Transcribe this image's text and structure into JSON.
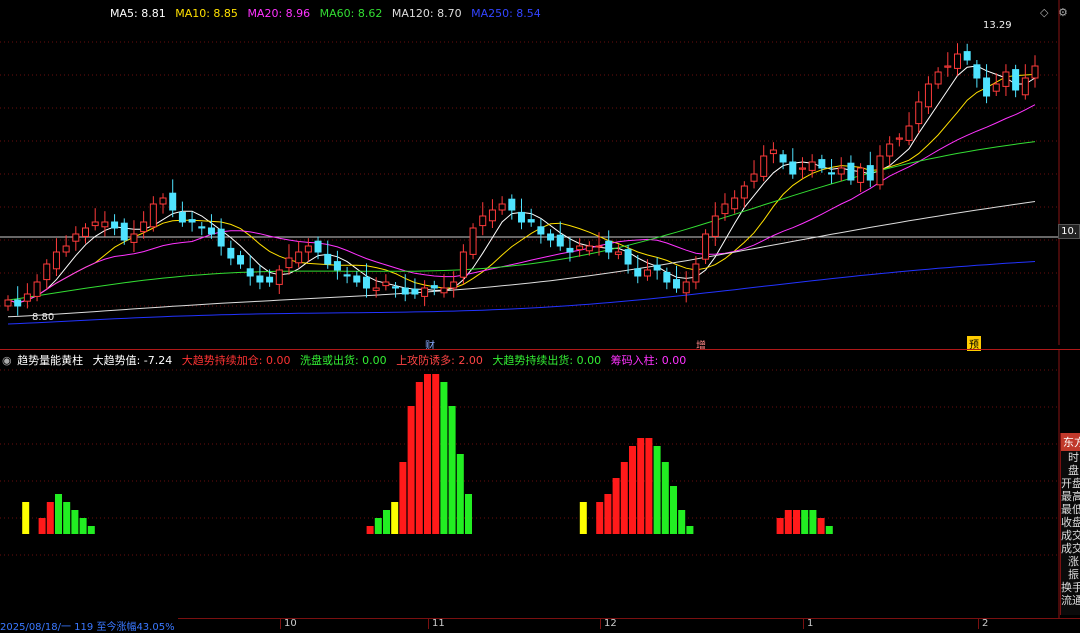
{
  "main": {
    "stock_title": "",
    "ma_legend": [
      {
        "label": "MA5: 8.81",
        "color": "#ffffff"
      },
      {
        "label": "MA10: 8.85",
        "color": "#ffe000"
      },
      {
        "label": "MA20: 8.96",
        "color": "#ff33ff"
      },
      {
        "label": "MA60: 8.62",
        "color": "#33dd33"
      },
      {
        "label": "MA120: 8.70",
        "color": "#dddddd"
      },
      {
        "label": "MA250: 8.54",
        "color": "#3344ff"
      }
    ],
    "high_label": "13.29",
    "low_label": "8.80",
    "right_price": "10.",
    "event_tags": [
      "财",
      "增",
      "预"
    ]
  },
  "indicator": {
    "name": "趋势量能黄柱",
    "legend": [
      {
        "label": "大趋势值: -7.24",
        "color": "#ffffff"
      },
      {
        "label": "大趋势持续加仓: 0.00",
        "color": "#ff3333"
      },
      {
        "label": "洗盘或出货: 0.00",
        "color": "#33ee33"
      },
      {
        "label": "上攻防诱多: 2.00",
        "color": "#ff4444"
      },
      {
        "label": "大趋势持续出货: 0.00",
        "color": "#33ee33"
      },
      {
        "label": "筹码入柱: 0.00",
        "color": "#ff33ff"
      }
    ],
    "colors": {
      "red": "#ff1a1a",
      "green": "#22ee22",
      "yellow": "#ffff00"
    }
  },
  "side_panel": {
    "header": "东方",
    "rows": [
      "时",
      "盘",
      "开盘",
      "最高",
      "最低",
      "收盘",
      "成交",
      "成交",
      "涨",
      "振",
      "换手",
      "流通"
    ]
  },
  "status_bar": {
    "text": "2025/08/18/一 119 至今涨幅43.05%",
    "months": [
      "10",
      "11",
      "12",
      "1",
      "2"
    ]
  },
  "chart_data": [
    {
      "type": "candlestick",
      "title": "",
      "y_range": [
        8.5,
        13.6
      ],
      "close_series": [
        9.0,
        8.9,
        9.1,
        9.3,
        9.6,
        9.8,
        9.9,
        10.1,
        10.2,
        10.3,
        10.3,
        10.2,
        10.0,
        10.1,
        10.3,
        10.6,
        10.7,
        10.5,
        10.3,
        10.3,
        10.2,
        10.1,
        9.9,
        9.7,
        9.6,
        9.4,
        9.3,
        9.3,
        9.5,
        9.7,
        9.8,
        9.9,
        9.8,
        9.6,
        9.5,
        9.4,
        9.3,
        9.2,
        9.2,
        9.3,
        9.2,
        9.1,
        9.1,
        9.2,
        9.2,
        9.2,
        9.3,
        9.8,
        10.2,
        10.4,
        10.5,
        10.6,
        10.5,
        10.3,
        10.3,
        10.1,
        10.0,
        9.9,
        9.8,
        9.9,
        9.9,
        9.9,
        9.8,
        9.8,
        9.6,
        9.4,
        9.5,
        9.5,
        9.3,
        9.2,
        9.3,
        9.6,
        10.1,
        10.4,
        10.6,
        10.7,
        10.9,
        11.1,
        11.4,
        11.5,
        11.3,
        11.1,
        11.2,
        11.3,
        11.2,
        11.1,
        11.2,
        11.0,
        11.2,
        11.0,
        11.4,
        11.6,
        11.7,
        11.9,
        12.3,
        12.6,
        12.8,
        12.9,
        13.1,
        13.0,
        12.7,
        12.4,
        12.6,
        12.8,
        12.5,
        12.7,
        12.9
      ],
      "ma_series": [
        {
          "name": "MA5"
        },
        {
          "name": "MA10"
        },
        {
          "name": "MA20"
        },
        {
          "name": "MA60"
        },
        {
          "name": "MA120"
        },
        {
          "name": "MA250"
        }
      ]
    },
    {
      "type": "bar",
      "title": "",
      "note": "",
      "values": [
        0,
        4,
        0,
        2,
        4,
        5,
        4,
        3,
        2,
        1,
        0,
        0,
        0,
        0,
        0,
        0,
        0,
        0,
        0,
        0,
        0,
        0,
        0,
        0,
        0,
        0,
        0,
        0,
        0,
        0,
        0,
        0,
        0,
        0,
        0,
        0,
        0,
        0,
        0,
        0,
        0,
        0,
        0,
        1,
        2,
        3,
        4,
        9,
        16,
        19,
        20,
        20,
        19,
        16,
        10,
        5,
        0,
        0,
        0,
        0,
        0,
        0,
        0,
        0,
        0,
        0,
        0,
        0,
        0,
        4,
        0,
        4,
        5,
        7,
        9,
        11,
        12,
        12,
        11,
        9,
        6,
        3,
        1,
        0,
        0,
        0,
        0,
        0,
        0,
        0,
        0,
        0,
        0,
        2,
        3,
        3,
        3,
        3,
        2,
        1,
        0
      ],
      "bar_colors": [
        "none",
        "yellow",
        "none",
        "red",
        "red",
        "green",
        "green",
        "green",
        "green",
        "green",
        "none",
        "none",
        "none",
        "none",
        "none",
        "none",
        "none",
        "none",
        "none",
        "none",
        "none",
        "none",
        "none",
        "none",
        "none",
        "none",
        "none",
        "none",
        "none",
        "none",
        "none",
        "none",
        "none",
        "none",
        "none",
        "none",
        "none",
        "none",
        "none",
        "none",
        "none",
        "none",
        "none",
        "red",
        "green",
        "green",
        "yellow",
        "red",
        "red",
        "red",
        "red",
        "red",
        "green",
        "green",
        "green",
        "green",
        "none",
        "none",
        "none",
        "none",
        "none",
        "none",
        "none",
        "none",
        "none",
        "none",
        "none",
        "none",
        "none",
        "yellow",
        "none",
        "red",
        "red",
        "red",
        "red",
        "red",
        "red",
        "red",
        "green",
        "green",
        "green",
        "green",
        "green",
        "none",
        "none",
        "none",
        "none",
        "none",
        "none",
        "none",
        "none",
        "none",
        "none",
        "red",
        "red",
        "red",
        "green",
        "green",
        "red",
        "green",
        "none"
      ]
    }
  ]
}
